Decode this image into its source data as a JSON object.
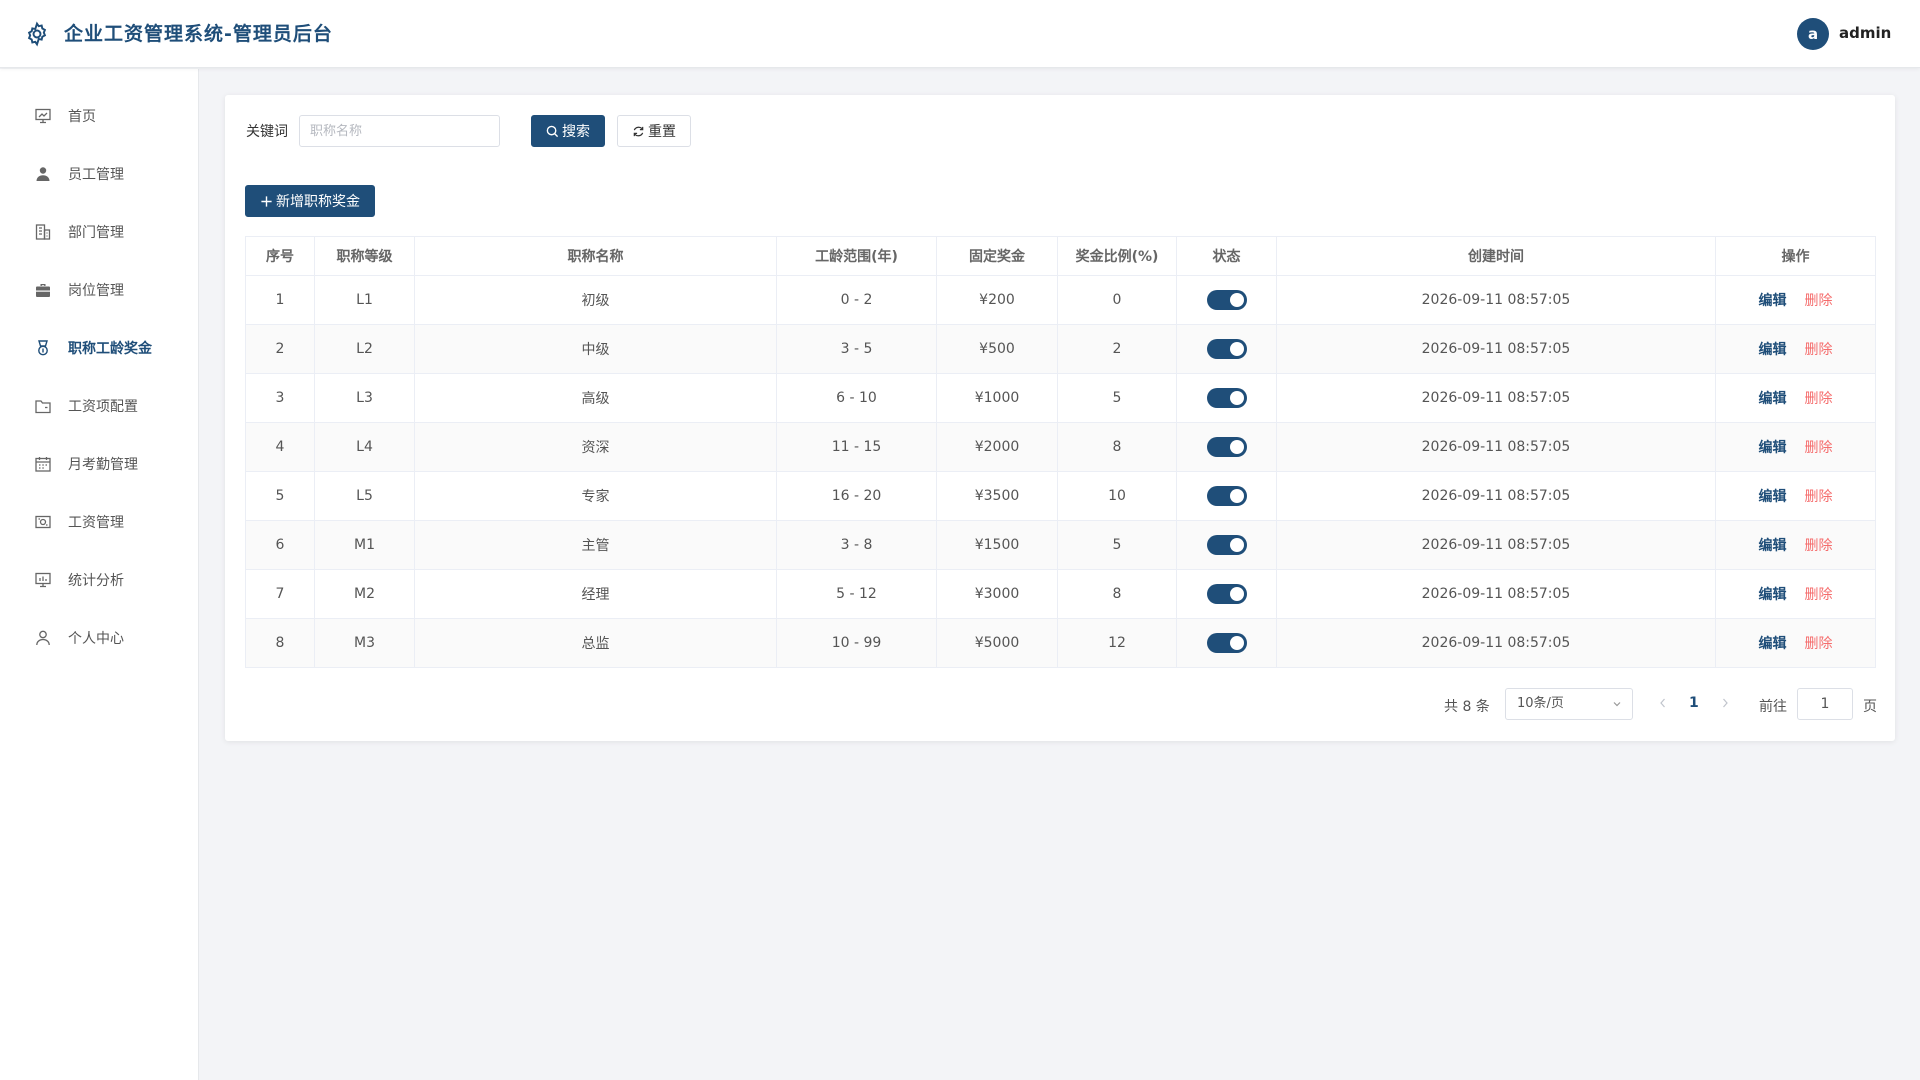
{
  "header": {
    "title": "企业工资管理系统-管理员后台",
    "avatar_letter": "a",
    "username": "admin"
  },
  "sidebar": {
    "items": [
      {
        "label": "首页",
        "icon": "chart-board-icon"
      },
      {
        "label": "员工管理",
        "icon": "user-icon"
      },
      {
        "label": "部门管理",
        "icon": "building-icon"
      },
      {
        "label": "岗位管理",
        "icon": "briefcase-icon"
      },
      {
        "label": "职称工龄奖金",
        "icon": "medal-icon",
        "active": true
      },
      {
        "label": "工资项配置",
        "icon": "folder-icon"
      },
      {
        "label": "月考勤管理",
        "icon": "calendar-icon"
      },
      {
        "label": "工资管理",
        "icon": "money-icon"
      },
      {
        "label": "统计分析",
        "icon": "chart-board-icon"
      },
      {
        "label": "个人中心",
        "icon": "user-outline-icon"
      }
    ]
  },
  "search": {
    "label": "关键词",
    "placeholder": "职称名称",
    "value": "",
    "search_button": "搜索",
    "reset_button": "重置"
  },
  "toolbar": {
    "add_button": "新增职称奖金"
  },
  "table": {
    "columns": [
      "序号",
      "职称等级",
      "职称名称",
      "工龄范围(年)",
      "固定奖金",
      "奖金比例(%)",
      "状态",
      "创建时间",
      "操作"
    ],
    "rows": [
      {
        "index": "1",
        "level": "L1",
        "name": "初级",
        "years": "0 - 2",
        "bonus": "¥200",
        "ratio": "0",
        "enabled": true,
        "created": "2026-09-11 08:57:05"
      },
      {
        "index": "2",
        "level": "L2",
        "name": "中级",
        "years": "3 - 5",
        "bonus": "¥500",
        "ratio": "2",
        "enabled": true,
        "created": "2026-09-11 08:57:05"
      },
      {
        "index": "3",
        "level": "L3",
        "name": "高级",
        "years": "6 - 10",
        "bonus": "¥1000",
        "ratio": "5",
        "enabled": true,
        "created": "2026-09-11 08:57:05"
      },
      {
        "index": "4",
        "level": "L4",
        "name": "资深",
        "years": "11 - 15",
        "bonus": "¥2000",
        "ratio": "8",
        "enabled": true,
        "created": "2026-09-11 08:57:05"
      },
      {
        "index": "5",
        "level": "L5",
        "name": "专家",
        "years": "16 - 20",
        "bonus": "¥3500",
        "ratio": "10",
        "enabled": true,
        "created": "2026-09-11 08:57:05"
      },
      {
        "index": "6",
        "level": "M1",
        "name": "主管",
        "years": "3 - 8",
        "bonus": "¥1500",
        "ratio": "5",
        "enabled": true,
        "created": "2026-09-11 08:57:05"
      },
      {
        "index": "7",
        "level": "M2",
        "name": "经理",
        "years": "5 - 12",
        "bonus": "¥3000",
        "ratio": "8",
        "enabled": true,
        "created": "2026-09-11 08:57:05"
      },
      {
        "index": "8",
        "level": "M3",
        "name": "总监",
        "years": "10 - 99",
        "bonus": "¥5000",
        "ratio": "12",
        "enabled": true,
        "created": "2026-09-11 08:57:05"
      }
    ],
    "edit_label": "编辑",
    "delete_label": "删除"
  },
  "pagination": {
    "total_text": "共 8 条",
    "page_size": "10条/页",
    "current_page": "1",
    "goto_label": "前往",
    "goto_value": "1",
    "goto_suffix": "页"
  },
  "colors": {
    "primary": "#1f4e79",
    "danger": "#f56c6c",
    "background": "#f3f4f7"
  }
}
